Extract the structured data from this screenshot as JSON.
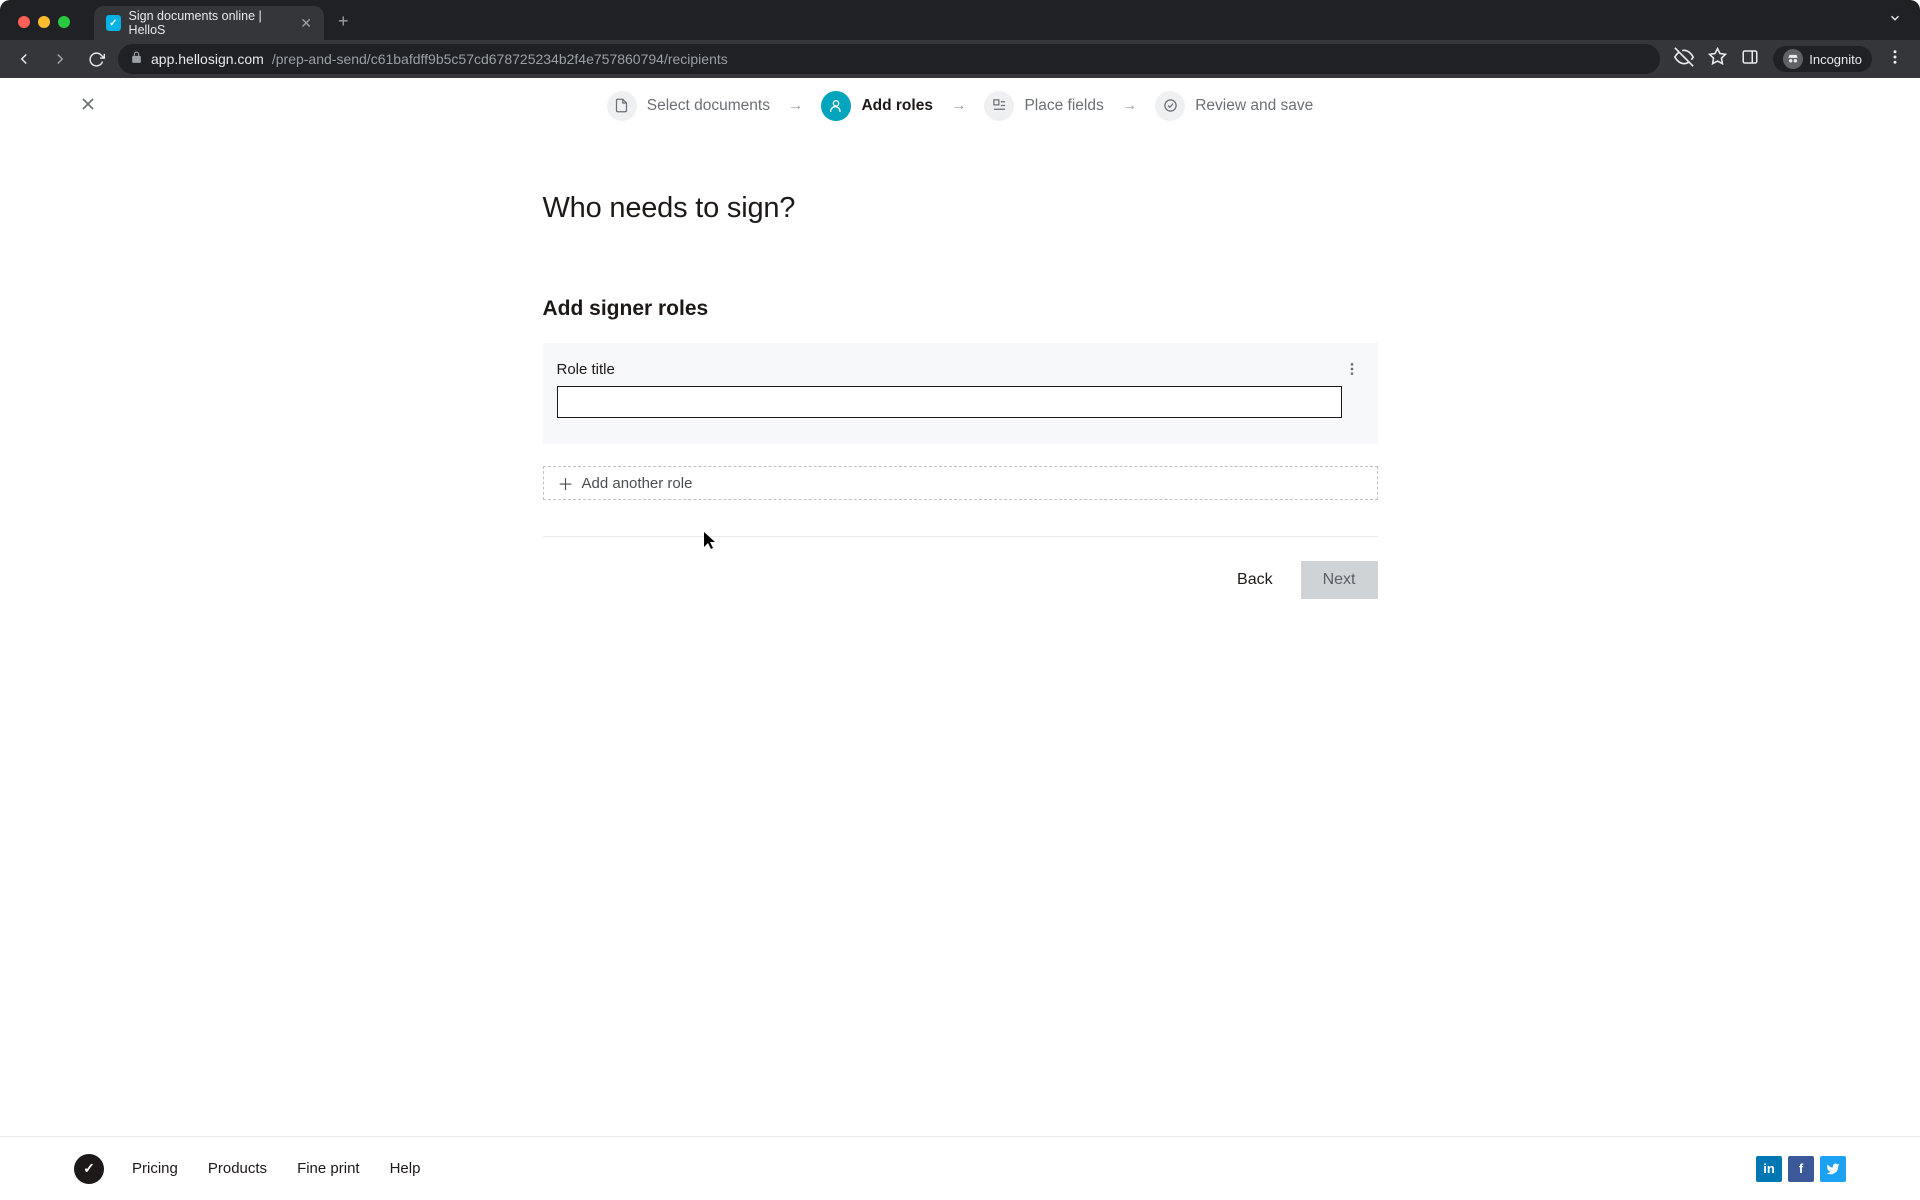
{
  "browser": {
    "tab_title": "Sign documents online | HelloS",
    "url_host": "app.hellosign.com",
    "url_path": "/prep-and-send/c61bafdff9b5c57cd678725234b2f4e757860794/recipients",
    "incognito_label": "Incognito"
  },
  "stepper": {
    "steps": [
      {
        "label": "Select documents"
      },
      {
        "label": "Add roles"
      },
      {
        "label": "Place fields"
      },
      {
        "label": "Review and save"
      }
    ],
    "active_index": 1
  },
  "main": {
    "headline": "Who needs to sign?",
    "section_title": "Add signer roles",
    "role_label": "Role title",
    "role_value": "",
    "add_role_label": "Add another role",
    "back_label": "Back",
    "next_label": "Next"
  },
  "footer": {
    "links": [
      "Pricing",
      "Products",
      "Fine print",
      "Help"
    ]
  }
}
